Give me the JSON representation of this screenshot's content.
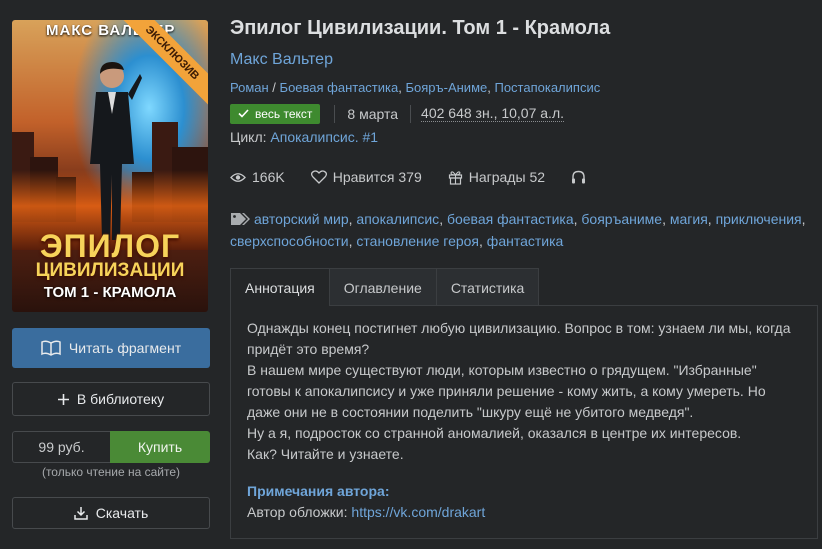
{
  "cover": {
    "author": "МАКС ВАЛЬТЕР",
    "ribbon": "ЭКСКЛЮЗИВ",
    "title_line1": "ЭПИЛОГ",
    "title_line2": "ЦИВИЛИЗАЦИИ",
    "title_line3": "ТОМ 1 - КРАМОЛА"
  },
  "actions": {
    "read_fragment": "Читать фрагмент",
    "add_library": "В библиотеку",
    "price": "99 руб.",
    "buy": "Купить",
    "buy_note": "(только чтение на сайте)",
    "download": "Скачать"
  },
  "book": {
    "title": "Эпилог Цивилизации. Том 1 - Крамола",
    "author": "Макс Вальтер",
    "genres": [
      "Роман",
      "Боевая фантастика",
      "Бояръ-Аниме",
      "Постапокалипсис"
    ],
    "status_badge": "весь текст",
    "date": "8 марта",
    "size": "402 648 зн., 10,07 а.л.",
    "cycle_label": "Цикл:",
    "cycle_name": "Апокалипсис. #1"
  },
  "stats": {
    "views": "166K",
    "likes_label": "Нравится",
    "likes": "379",
    "awards_label": "Награды",
    "awards": "52"
  },
  "tags": [
    "авторский мир",
    "апокалипсис",
    "боевая фантастика",
    "бояръаниме",
    "магия",
    "приключения",
    "сверхспособности",
    "становление героя",
    "фантастика"
  ],
  "tabs": [
    "Аннотация",
    "Оглавление",
    "Статистика"
  ],
  "annotation": {
    "paragraphs": [
      "Однажды конец постигнет любую цивилизацию. Вопрос в том: узнаем ли мы, когда придёт это время?",
      "В нашем мире существуют люди, которым известно о грядущем. \"Избранные\" готовы к апокалипсису и уже приняли решение - кому жить, а кому умереть. Но даже они не в состоянии поделить \"шкуру ещё не убитого медведя\".",
      "Ну а я, подросток со странной аномалией, оказался в центре их интересов.",
      "Как? Читайте и узнаете."
    ],
    "author_note_title": "Примечания автора:",
    "cover_credit_label": "Автор обложки:",
    "cover_credit_link": "https://vk.com/drakart"
  },
  "colors": {
    "background": "#242628",
    "link": "#6fa5d9",
    "read_button": "#3a6d9e",
    "buy_button": "#4a8a36",
    "badge": "#3e8a2f"
  }
}
